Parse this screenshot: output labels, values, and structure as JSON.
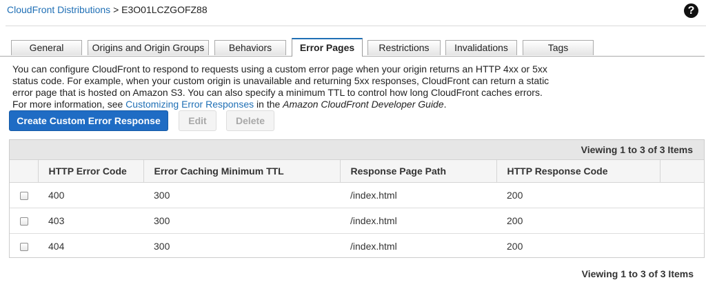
{
  "breadcrumb": {
    "parent": "CloudFront Distributions",
    "separator": ">",
    "current": "E3O01LCZGOFZ88"
  },
  "help": {
    "icon": "question-circle-icon",
    "glyph": "?"
  },
  "tabs": [
    {
      "label": "General"
    },
    {
      "label": "Origins and Origin Groups"
    },
    {
      "label": "Behaviors"
    },
    {
      "label": "Error Pages"
    },
    {
      "label": "Restrictions"
    },
    {
      "label": "Invalidations"
    },
    {
      "label": "Tags"
    }
  ],
  "active_tab": "Error Pages",
  "description": {
    "text_before_link": "You can configure CloudFront to respond to requests using a custom error page when your origin returns an HTTP 4xx or 5xx status code. For example, when your custom origin is unavailable and returning 5xx responses, CloudFront can return a static error page that is hosted on Amazon S3. You can also specify a minimum TTL to control how long CloudFront caches errors. For more information, see ",
    "link_text": "Customizing Error Responses",
    "text_after_link": " in the ",
    "guide_title": "Amazon CloudFront Developer Guide",
    "text_end": "."
  },
  "actions": {
    "create_label": "Create Custom Error Response",
    "edit_label": "Edit",
    "delete_label": "Delete"
  },
  "table": {
    "viewing_label": "Viewing 1 to 3 of 3 Items",
    "columns": [
      "HTTP Error Code",
      "Error Caching Minimum TTL",
      "Response Page Path",
      "HTTP Response Code"
    ],
    "rows": [
      {
        "error_code": "400",
        "ttl": "300",
        "path": "/index.html",
        "response_code": "200"
      },
      {
        "error_code": "403",
        "ttl": "300",
        "path": "/index.html",
        "response_code": "200"
      },
      {
        "error_code": "404",
        "ttl": "300",
        "path": "/index.html",
        "response_code": "200"
      }
    ]
  },
  "colors": {
    "link": "#1f6fb5",
    "primary_button": "#1f6cc4",
    "active_tab_accent": "#1f6fb5"
  }
}
